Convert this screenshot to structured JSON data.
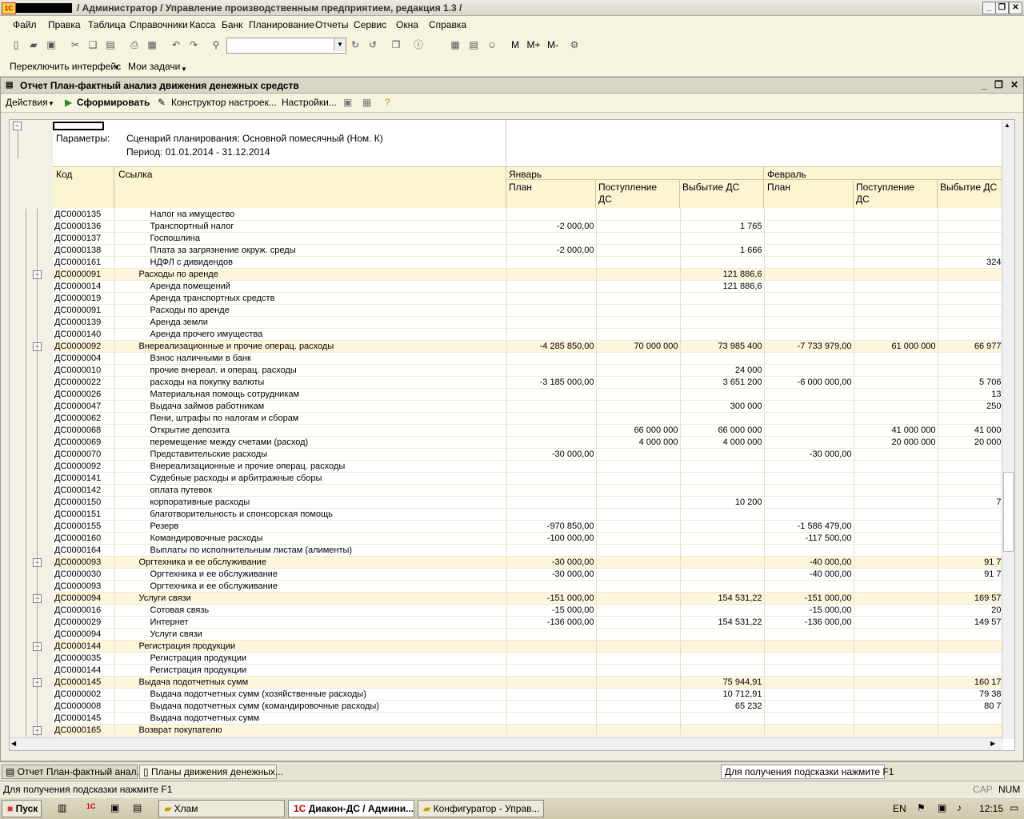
{
  "window": {
    "title": "/ Администратор /  Управление производственным предприятием, редакция 1.3 /",
    "buttons": [
      "_",
      "❐",
      "✕"
    ]
  },
  "menu": [
    "Файл",
    "Правка",
    "Таблица",
    "Справочники",
    "Касса",
    "Банк",
    "Планирование",
    "Отчеты",
    "Сервис",
    "Окна",
    "Справка"
  ],
  "toolbar2": {
    "switch_interface": "Переключить интерфейс",
    "my_tasks": "Мои задачи"
  },
  "toolbar_calc": [
    "M",
    "M+",
    "M-"
  ],
  "document": {
    "title": "Отчет  План-фактный анализ движения денежных средств",
    "actions": "Действия",
    "generate": "Сформировать",
    "constructor": "Конструктор настроек...",
    "settings": "Настройки..."
  },
  "report": {
    "params_label": "Параметры:",
    "param_scenario": "Сценарий планирования: Основной помесячный (Ном. К)",
    "param_period": "Период: 01.01.2014 - 31.12.2014",
    "col_code": "Код",
    "col_ref": "Ссылка",
    "month1": "Январь",
    "month2": "Февраль",
    "sub_plan": "План",
    "sub_in_1": "Поступление",
    "sub_in_2": "ДС",
    "sub_out": "Выбытие ДС",
    "rows": [
      {
        "code": "ДС0000135",
        "name": "Налог на имущество",
        "lvl": 2,
        "v": [
          "",
          "",
          "",
          "",
          "",
          ""
        ]
      },
      {
        "code": "ДС0000136",
        "name": "Транспортный налог",
        "lvl": 2,
        "v": [
          "-2 000,00",
          "",
          "1 765",
          "",
          "",
          ""
        ]
      },
      {
        "code": "ДС0000137",
        "name": "Госпошлина",
        "lvl": 2,
        "v": [
          "",
          "",
          "",
          "",
          "",
          ""
        ]
      },
      {
        "code": "ДС0000138",
        "name": "Плата за загрязнение окруж. среды",
        "lvl": 2,
        "v": [
          "-2 000,00",
          "",
          "1 666",
          "",
          "",
          ""
        ]
      },
      {
        "code": "ДС0000161",
        "name": "НДФЛ с дивидендов",
        "lvl": 2,
        "v": [
          "",
          "",
          "",
          "",
          "",
          "324"
        ]
      },
      {
        "code": "ДС0000091",
        "name": "Расходы по аренде",
        "lvl": 1,
        "v": [
          "",
          "",
          "121 886,6",
          "",
          "",
          ""
        ]
      },
      {
        "code": "ДС0000014",
        "name": "Аренда помещений",
        "lvl": 2,
        "v": [
          "",
          "",
          "121 886,6",
          "",
          "",
          ""
        ]
      },
      {
        "code": "ДС0000019",
        "name": "Аренда транспортных средств",
        "lvl": 2,
        "v": [
          "",
          "",
          "",
          "",
          "",
          ""
        ]
      },
      {
        "code": "ДС0000091",
        "name": "Расходы по аренде",
        "lvl": 2,
        "v": [
          "",
          "",
          "",
          "",
          "",
          ""
        ]
      },
      {
        "code": "ДС0000139",
        "name": "Аренда земли",
        "lvl": 2,
        "v": [
          "",
          "",
          "",
          "",
          "",
          ""
        ]
      },
      {
        "code": "ДС0000140",
        "name": "Аренда прочего имущества",
        "lvl": 2,
        "v": [
          "",
          "",
          "",
          "",
          "",
          ""
        ]
      },
      {
        "code": "ДС0000092",
        "name": "Внереализационные и прочие операц. расходы",
        "lvl": 1,
        "v": [
          "-4 285 850,00",
          "70 000 000",
          "73 985 400",
          "-7 733 979,00",
          "61 000 000",
          "66 977"
        ]
      },
      {
        "code": "ДС0000004",
        "name": "Взнос наличными в банк",
        "lvl": 2,
        "v": [
          "",
          "",
          "",
          "",
          "",
          ""
        ]
      },
      {
        "code": "ДС0000010",
        "name": "прочие внереал. и операц. расходы",
        "lvl": 2,
        "v": [
          "",
          "",
          "24 000",
          "",
          "",
          ""
        ]
      },
      {
        "code": "ДС0000022",
        "name": "расходы на покупку валюты",
        "lvl": 2,
        "v": [
          "-3 185 000,00",
          "",
          "3 651 200",
          "-6 000 000,00",
          "",
          "5 706"
        ]
      },
      {
        "code": "ДС0000026",
        "name": "Материальная помощь сотрудникам",
        "lvl": 2,
        "v": [
          "",
          "",
          "",
          "",
          "",
          "13"
        ]
      },
      {
        "code": "ДС0000047",
        "name": "Выдача займов работникам",
        "lvl": 2,
        "v": [
          "",
          "",
          "300 000",
          "",
          "",
          "250"
        ]
      },
      {
        "code": "ДС0000062",
        "name": "Пени, штрафы по налогам и сборам",
        "lvl": 2,
        "v": [
          "",
          "",
          "",
          "",
          "",
          ""
        ]
      },
      {
        "code": "ДС0000068",
        "name": "Открытие депозита",
        "lvl": 2,
        "v": [
          "",
          "66 000 000",
          "66 000 000",
          "",
          "41 000 000",
          "41 000"
        ]
      },
      {
        "code": "ДС0000069",
        "name": "перемещение между счетами (расход)",
        "lvl": 2,
        "v": [
          "",
          "4 000 000",
          "4 000 000",
          "",
          "20 000 000",
          "20 000"
        ]
      },
      {
        "code": "ДС0000070",
        "name": "Представительские расходы",
        "lvl": 2,
        "v": [
          "-30 000,00",
          "",
          "",
          "-30 000,00",
          "",
          ""
        ]
      },
      {
        "code": "ДС0000092",
        "name": "Внереализационные и прочие операц. расходы",
        "lvl": 2,
        "v": [
          "",
          "",
          "",
          "",
          "",
          ""
        ]
      },
      {
        "code": "ДС0000141",
        "name": "Судебные расходы и арбитражные сборы",
        "lvl": 2,
        "v": [
          "",
          "",
          "",
          "",
          "",
          ""
        ]
      },
      {
        "code": "ДС0000142",
        "name": "оплата путевок",
        "lvl": 2,
        "v": [
          "",
          "",
          "",
          "",
          "",
          ""
        ]
      },
      {
        "code": "ДС0000150",
        "name": "корпоративные расходы",
        "lvl": 2,
        "v": [
          "",
          "",
          "10 200",
          "",
          "",
          "7"
        ]
      },
      {
        "code": "ДС0000151",
        "name": "благотворительность и спонсорская помощь",
        "lvl": 2,
        "v": [
          "",
          "",
          "",
          "",
          "",
          ""
        ]
      },
      {
        "code": "ДС0000155",
        "name": "Резерв",
        "lvl": 2,
        "v": [
          "-970 850,00",
          "",
          "",
          "-1 586 479,00",
          "",
          ""
        ]
      },
      {
        "code": "ДС0000160",
        "name": "Командировочные расходы",
        "lvl": 2,
        "v": [
          "-100 000,00",
          "",
          "",
          "-117 500,00",
          "",
          ""
        ]
      },
      {
        "code": "ДС0000164",
        "name": "Выплаты по исполнительным листам (алименты)",
        "lvl": 2,
        "v": [
          "",
          "",
          "",
          "",
          "",
          ""
        ]
      },
      {
        "code": "ДС0000093",
        "name": "Оргтехника и ее обслуживание",
        "lvl": 1,
        "v": [
          "-30 000,00",
          "",
          "",
          "-40 000,00",
          "",
          "91 7"
        ]
      },
      {
        "code": "ДС0000030",
        "name": "Оргтехника и ее обслуживание",
        "lvl": 2,
        "v": [
          "-30 000,00",
          "",
          "",
          "-40 000,00",
          "",
          "91 7"
        ]
      },
      {
        "code": "ДС0000093",
        "name": "Оргтехника и ее обслуживание",
        "lvl": 2,
        "v": [
          "",
          "",
          "",
          "",
          "",
          ""
        ]
      },
      {
        "code": "ДС0000094",
        "name": "Услуги связи",
        "lvl": 1,
        "v": [
          "-151 000,00",
          "",
          "154 531,22",
          "-151 000,00",
          "",
          "169 57"
        ]
      },
      {
        "code": "ДС0000016",
        "name": "Сотовая связь",
        "lvl": 2,
        "v": [
          "-15 000,00",
          "",
          "",
          "-15 000,00",
          "",
          "20"
        ]
      },
      {
        "code": "ДС0000029",
        "name": "Интернет",
        "lvl": 2,
        "v": [
          "-136 000,00",
          "",
          "154 531,22",
          "-136 000,00",
          "",
          "149 57"
        ]
      },
      {
        "code": "ДС0000094",
        "name": "Услуги связи",
        "lvl": 2,
        "v": [
          "",
          "",
          "",
          "",
          "",
          ""
        ]
      },
      {
        "code": "ДС0000144",
        "name": "Регистрация продукции",
        "lvl": 1,
        "v": [
          "",
          "",
          "",
          "",
          "",
          ""
        ]
      },
      {
        "code": "ДС0000035",
        "name": "Регистрация продукции",
        "lvl": 2,
        "v": [
          "",
          "",
          "",
          "",
          "",
          ""
        ]
      },
      {
        "code": "ДС0000144",
        "name": "Регистрация продукции",
        "lvl": 2,
        "v": [
          "",
          "",
          "",
          "",
          "",
          ""
        ]
      },
      {
        "code": "ДС0000145",
        "name": "Выдача подотчетных сумм",
        "lvl": 1,
        "v": [
          "",
          "",
          "75 944,91",
          "",
          "",
          "160 17"
        ]
      },
      {
        "code": "ДС0000002",
        "name": "Выдача подотчетных сумм (хозяйственные расходы)",
        "lvl": 2,
        "v": [
          "",
          "",
          "10 712,91",
          "",
          "",
          "79 38"
        ]
      },
      {
        "code": "ДС0000008",
        "name": "Выдача подотчетных сумм (командировочные расходы)",
        "lvl": 2,
        "v": [
          "",
          "",
          "65 232",
          "",
          "",
          "80 7"
        ]
      },
      {
        "code": "ДС0000145",
        "name": "Выдача подотчетных сумм",
        "lvl": 2,
        "v": [
          "",
          "",
          "",
          "",
          "",
          ""
        ]
      },
      {
        "code": "ДС0000165",
        "name": "Возврат покупателю",
        "lvl": 1,
        "v": [
          "",
          "",
          "",
          "",
          "",
          ""
        ]
      }
    ]
  },
  "window_tabs": [
    "Отчет  План-фактный анал...",
    "Планы движения денежных..."
  ],
  "tooltip": "Для получения подсказки нажмите F1",
  "status": {
    "text": "Для получения подсказки нажмите F1",
    "cap": "CAP",
    "num": "NUM"
  },
  "taskbar": {
    "start": "Пуск",
    "b1": "Хлам",
    "b2": "Диакон-ДС / Админи...",
    "b3": "Конфигуратор - Управ...",
    "lang": "EN",
    "time": "12:15"
  }
}
